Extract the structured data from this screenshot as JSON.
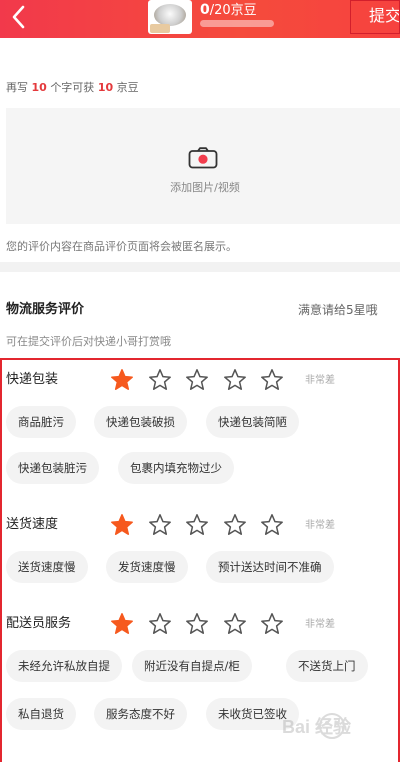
{
  "header": {
    "back_icon": "chevron-left-icon",
    "bean_progress": "0",
    "bean_total": "/20京豆",
    "submit_label": "提交",
    "background_color": "#f2394b"
  },
  "review": {
    "hint_prefix": "再写",
    "hint_count": "10",
    "hint_middle": "个字可获",
    "hint_reward": "10",
    "hint_suffix": "京豆",
    "upload_label": "添加图片/视频",
    "anon_note": "您的评价内容在商品评价页面将会被匿名展示。"
  },
  "logistics": {
    "title": "物流服务评价",
    "right_text": "满意请给5星哦",
    "subtitle": "可在提交评价后对快递小哥打赏哦"
  },
  "categories": [
    {
      "label": "快递包装",
      "rating": 1,
      "max_rating": 5,
      "level": "非常差",
      "tags": [
        "商品脏污",
        "快递包装破损",
        "快递包装简陋",
        "快递包装脏污",
        "包裹内填充物过少"
      ]
    },
    {
      "label": "送货速度",
      "rating": 1,
      "max_rating": 5,
      "level": "非常差",
      "tags": [
        "送货速度慢",
        "发货速度慢",
        "预计送达时间不准确"
      ]
    },
    {
      "label": "配送员服务",
      "rating": 1,
      "max_rating": 5,
      "level": "非常差",
      "tags": [
        "未经允许私放自提",
        "附近没有自提点/柜",
        "不送货上门",
        "私自退货",
        "服务态度不好",
        "未收货已签收"
      ]
    }
  ],
  "colors": {
    "accent_red": "#e4393c",
    "star_filled": "#f6591e",
    "frame_red": "#e3262f"
  },
  "watermark_text": "Bai 经验"
}
